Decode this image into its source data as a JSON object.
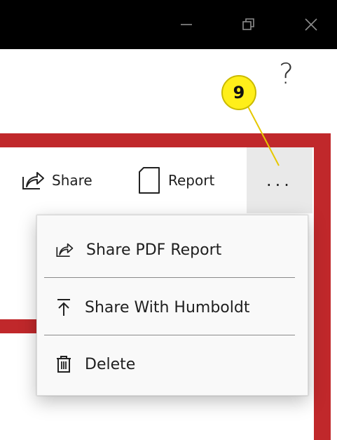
{
  "window": {
    "minimize_icon": "minimize-icon",
    "restore_icon": "restore-icon",
    "close_icon": "close-icon"
  },
  "help": {
    "label": "?"
  },
  "callout": {
    "number": "9",
    "color": "#ffef1a"
  },
  "toolbar": {
    "share_label": "Share",
    "report_label": "Report",
    "more_label": "..."
  },
  "menu": {
    "items": [
      {
        "label": "Share PDF Report",
        "icon": "share-icon"
      },
      {
        "label": "Share With Humboldt",
        "icon": "upload-icon"
      },
      {
        "label": "Delete",
        "icon": "trash-icon"
      }
    ]
  },
  "colors": {
    "frame_red": "#c0282b",
    "titlebar": "#000000",
    "menu_bg": "#f9f9f9",
    "more_bg": "#e9e9e9"
  }
}
